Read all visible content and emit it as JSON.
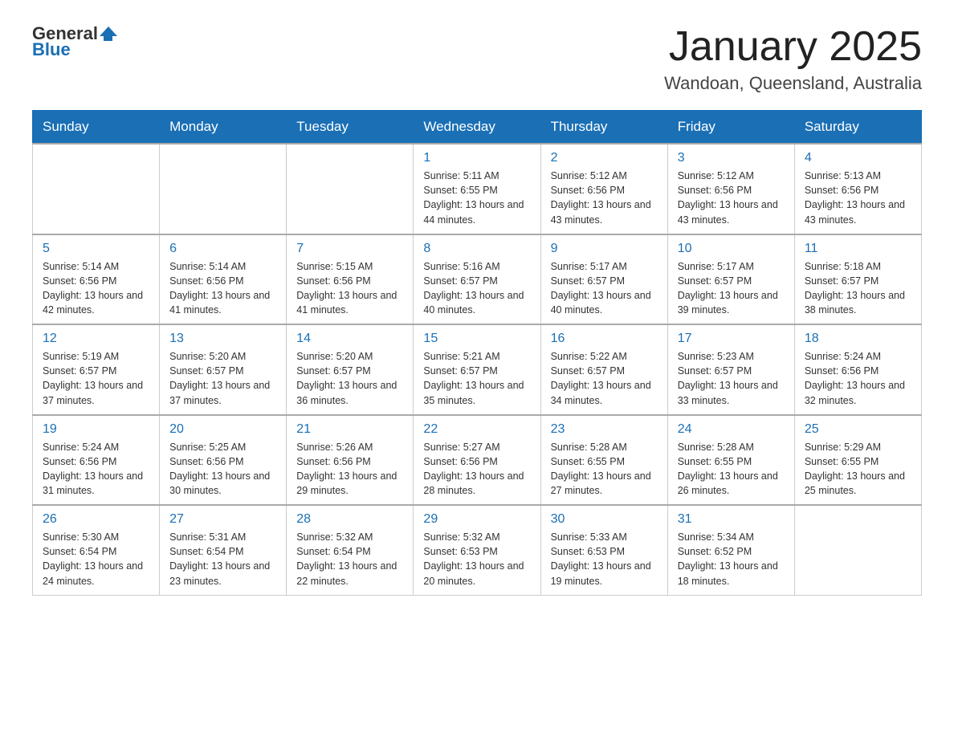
{
  "header": {
    "logo_general": "General",
    "logo_blue": "Blue",
    "month_title": "January 2025",
    "location": "Wandoan, Queensland, Australia"
  },
  "days_of_week": [
    "Sunday",
    "Monday",
    "Tuesday",
    "Wednesday",
    "Thursday",
    "Friday",
    "Saturday"
  ],
  "weeks": [
    [
      {
        "day": "",
        "info": ""
      },
      {
        "day": "",
        "info": ""
      },
      {
        "day": "",
        "info": ""
      },
      {
        "day": "1",
        "info": "Sunrise: 5:11 AM\nSunset: 6:55 PM\nDaylight: 13 hours\nand 44 minutes."
      },
      {
        "day": "2",
        "info": "Sunrise: 5:12 AM\nSunset: 6:56 PM\nDaylight: 13 hours\nand 43 minutes."
      },
      {
        "day": "3",
        "info": "Sunrise: 5:12 AM\nSunset: 6:56 PM\nDaylight: 13 hours\nand 43 minutes."
      },
      {
        "day": "4",
        "info": "Sunrise: 5:13 AM\nSunset: 6:56 PM\nDaylight: 13 hours\nand 43 minutes."
      }
    ],
    [
      {
        "day": "5",
        "info": "Sunrise: 5:14 AM\nSunset: 6:56 PM\nDaylight: 13 hours\nand 42 minutes."
      },
      {
        "day": "6",
        "info": "Sunrise: 5:14 AM\nSunset: 6:56 PM\nDaylight: 13 hours\nand 41 minutes."
      },
      {
        "day": "7",
        "info": "Sunrise: 5:15 AM\nSunset: 6:56 PM\nDaylight: 13 hours\nand 41 minutes."
      },
      {
        "day": "8",
        "info": "Sunrise: 5:16 AM\nSunset: 6:57 PM\nDaylight: 13 hours\nand 40 minutes."
      },
      {
        "day": "9",
        "info": "Sunrise: 5:17 AM\nSunset: 6:57 PM\nDaylight: 13 hours\nand 40 minutes."
      },
      {
        "day": "10",
        "info": "Sunrise: 5:17 AM\nSunset: 6:57 PM\nDaylight: 13 hours\nand 39 minutes."
      },
      {
        "day": "11",
        "info": "Sunrise: 5:18 AM\nSunset: 6:57 PM\nDaylight: 13 hours\nand 38 minutes."
      }
    ],
    [
      {
        "day": "12",
        "info": "Sunrise: 5:19 AM\nSunset: 6:57 PM\nDaylight: 13 hours\nand 37 minutes."
      },
      {
        "day": "13",
        "info": "Sunrise: 5:20 AM\nSunset: 6:57 PM\nDaylight: 13 hours\nand 37 minutes."
      },
      {
        "day": "14",
        "info": "Sunrise: 5:20 AM\nSunset: 6:57 PM\nDaylight: 13 hours\nand 36 minutes."
      },
      {
        "day": "15",
        "info": "Sunrise: 5:21 AM\nSunset: 6:57 PM\nDaylight: 13 hours\nand 35 minutes."
      },
      {
        "day": "16",
        "info": "Sunrise: 5:22 AM\nSunset: 6:57 PM\nDaylight: 13 hours\nand 34 minutes."
      },
      {
        "day": "17",
        "info": "Sunrise: 5:23 AM\nSunset: 6:57 PM\nDaylight: 13 hours\nand 33 minutes."
      },
      {
        "day": "18",
        "info": "Sunrise: 5:24 AM\nSunset: 6:56 PM\nDaylight: 13 hours\nand 32 minutes."
      }
    ],
    [
      {
        "day": "19",
        "info": "Sunrise: 5:24 AM\nSunset: 6:56 PM\nDaylight: 13 hours\nand 31 minutes."
      },
      {
        "day": "20",
        "info": "Sunrise: 5:25 AM\nSunset: 6:56 PM\nDaylight: 13 hours\nand 30 minutes."
      },
      {
        "day": "21",
        "info": "Sunrise: 5:26 AM\nSunset: 6:56 PM\nDaylight: 13 hours\nand 29 minutes."
      },
      {
        "day": "22",
        "info": "Sunrise: 5:27 AM\nSunset: 6:56 PM\nDaylight: 13 hours\nand 28 minutes."
      },
      {
        "day": "23",
        "info": "Sunrise: 5:28 AM\nSunset: 6:55 PM\nDaylight: 13 hours\nand 27 minutes."
      },
      {
        "day": "24",
        "info": "Sunrise: 5:28 AM\nSunset: 6:55 PM\nDaylight: 13 hours\nand 26 minutes."
      },
      {
        "day": "25",
        "info": "Sunrise: 5:29 AM\nSunset: 6:55 PM\nDaylight: 13 hours\nand 25 minutes."
      }
    ],
    [
      {
        "day": "26",
        "info": "Sunrise: 5:30 AM\nSunset: 6:54 PM\nDaylight: 13 hours\nand 24 minutes."
      },
      {
        "day": "27",
        "info": "Sunrise: 5:31 AM\nSunset: 6:54 PM\nDaylight: 13 hours\nand 23 minutes."
      },
      {
        "day": "28",
        "info": "Sunrise: 5:32 AM\nSunset: 6:54 PM\nDaylight: 13 hours\nand 22 minutes."
      },
      {
        "day": "29",
        "info": "Sunrise: 5:32 AM\nSunset: 6:53 PM\nDaylight: 13 hours\nand 20 minutes."
      },
      {
        "day": "30",
        "info": "Sunrise: 5:33 AM\nSunset: 6:53 PM\nDaylight: 13 hours\nand 19 minutes."
      },
      {
        "day": "31",
        "info": "Sunrise: 5:34 AM\nSunset: 6:52 PM\nDaylight: 13 hours\nand 18 minutes."
      },
      {
        "day": "",
        "info": ""
      }
    ]
  ]
}
